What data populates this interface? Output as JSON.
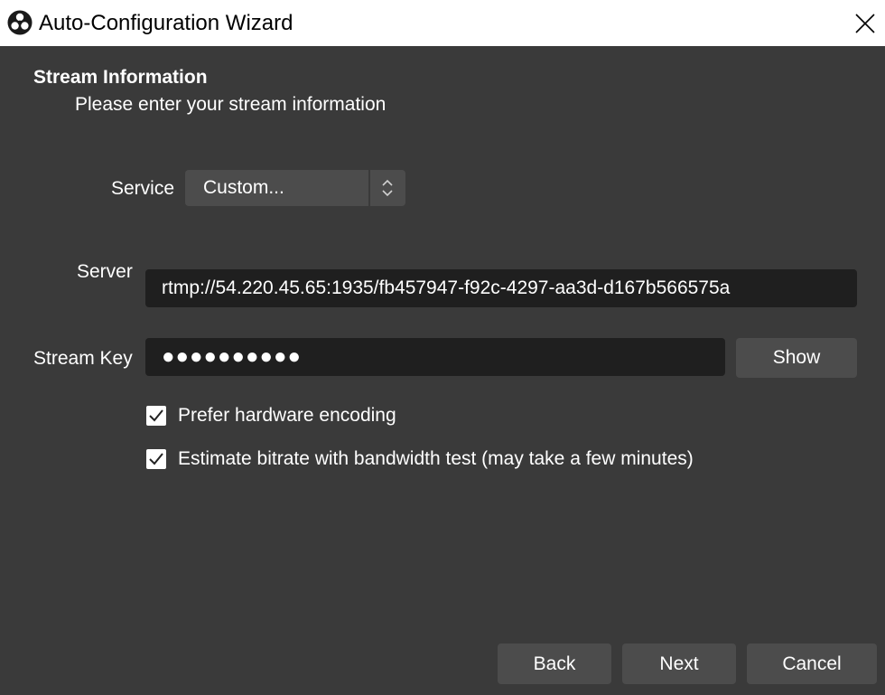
{
  "window": {
    "title": "Auto-Configuration Wizard",
    "app_icon": "obs-logo-icon",
    "close_icon": "close-icon"
  },
  "page": {
    "heading": "Stream Information",
    "subheading": "Please enter your stream information"
  },
  "form": {
    "service_label": "Service",
    "service_value": "Custom...",
    "server_label": "Server",
    "server_value": "rtmp://54.220.45.65:1935/fb457947-f92c-4297-aa3d-d167b566575a",
    "stream_key_label": "Stream Key",
    "stream_key_masked": "●●●●●●●●●●",
    "show_button": "Show",
    "checkboxes": [
      {
        "label": "Prefer hardware encoding",
        "checked": true
      },
      {
        "label": "Estimate bitrate with bandwidth test (may take a few minutes)",
        "checked": true
      }
    ]
  },
  "footer": {
    "back": "Back",
    "next": "Next",
    "cancel": "Cancel"
  },
  "colors": {
    "background": "#3a3a3a",
    "titlebar": "#ffffff",
    "input_bg": "#1f1f1f",
    "button_bg": "#4c4c4c"
  }
}
